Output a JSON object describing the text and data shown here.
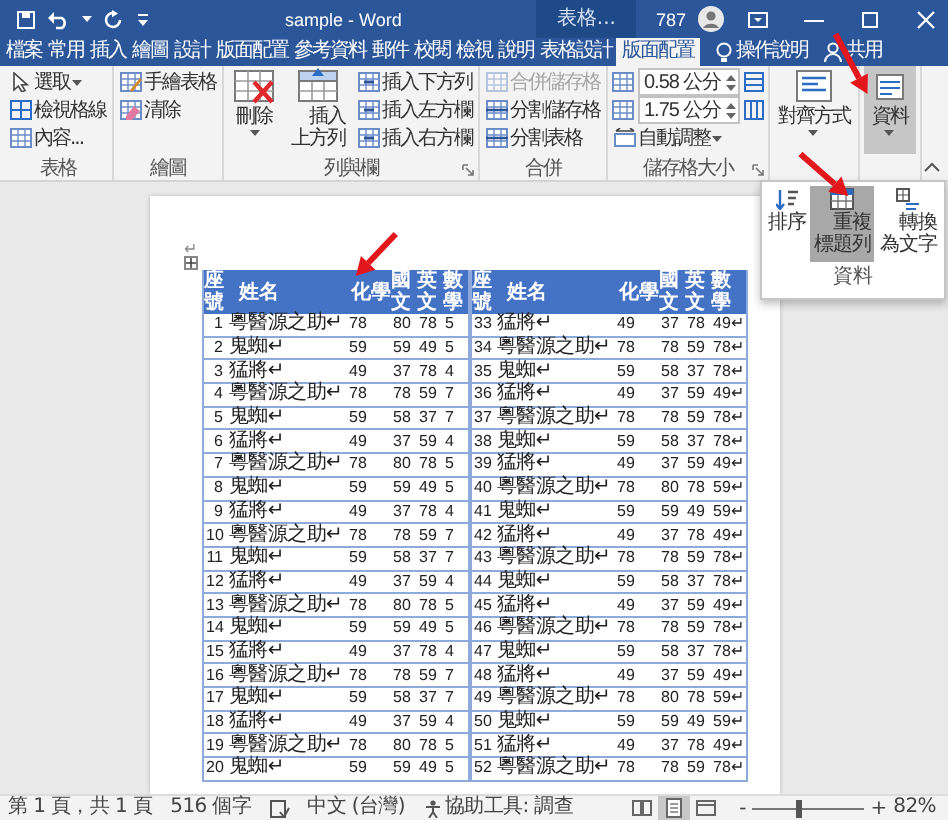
{
  "window": {
    "title": "sample - Word",
    "context_tab_group": "表格...",
    "count": "787"
  },
  "tabs": [
    {
      "label": "檔案",
      "selected": false
    },
    {
      "label": "常用",
      "selected": false
    },
    {
      "label": "插入",
      "selected": false
    },
    {
      "label": "繪圖",
      "selected": false
    },
    {
      "label": "設計",
      "selected": false
    },
    {
      "label": "版面配置",
      "selected": false
    },
    {
      "label": "參考資料",
      "selected": false
    },
    {
      "label": "郵件",
      "selected": false
    },
    {
      "label": "校閱",
      "selected": false
    },
    {
      "label": "檢視",
      "selected": false
    },
    {
      "label": "說明",
      "selected": false
    },
    {
      "label": "表格設計",
      "selected": false
    },
    {
      "label": "版面配置",
      "selected": true
    }
  ],
  "tell_me": "操作說明",
  "share": "共用",
  "ribbon": {
    "groups": [
      {
        "label": "表格",
        "launcher": false,
        "items": [
          {
            "kind": "small",
            "label": "選取",
            "dropdown": true,
            "disabled": false,
            "selected": false
          },
          {
            "kind": "small",
            "label": "檢視格線",
            "dropdown": false,
            "disabled": false,
            "selected": false
          },
          {
            "kind": "small",
            "label": "內容...",
            "dropdown": false,
            "disabled": false,
            "selected": false
          }
        ]
      },
      {
        "label": "繪圖",
        "launcher": false,
        "items": [
          {
            "kind": "small",
            "label": "手繪表格",
            "dropdown": false,
            "disabled": false,
            "selected": false
          },
          {
            "kind": "small",
            "label": "清除",
            "dropdown": false,
            "disabled": false,
            "selected": false
          }
        ]
      },
      {
        "label": "列與欄",
        "launcher": true,
        "items": [
          {
            "kind": "large",
            "label": "刪除",
            "dropdown": true,
            "disabled": false,
            "selected": false
          },
          {
            "kind": "large",
            "label": "插入上方列",
            "dropdown": false,
            "disabled": false,
            "selected": false
          },
          {
            "kind": "small",
            "label": "插入下方列",
            "dropdown": false,
            "disabled": false,
            "selected": false
          },
          {
            "kind": "small",
            "label": "插入左方欄",
            "dropdown": false,
            "disabled": false,
            "selected": false
          },
          {
            "kind": "small",
            "label": "插入右方欄",
            "dropdown": false,
            "disabled": false,
            "selected": false
          }
        ]
      },
      {
        "label": "合併",
        "launcher": false,
        "items": [
          {
            "kind": "small",
            "label": "合併儲存格",
            "dropdown": false,
            "disabled": true,
            "selected": false
          },
          {
            "kind": "small",
            "label": "分割儲存格",
            "dropdown": false,
            "disabled": false,
            "selected": false
          },
          {
            "kind": "small",
            "label": "分割表格",
            "dropdown": false,
            "disabled": false,
            "selected": false
          }
        ]
      },
      {
        "label": "儲存格大小",
        "launcher": true,
        "items": [
          {
            "kind": "spin",
            "value": "0.58 公分"
          },
          {
            "kind": "spin",
            "value": "1.75 公分"
          },
          {
            "kind": "small",
            "label": "自動調整",
            "dropdown": true,
            "disabled": false,
            "selected": false
          }
        ]
      },
      {
        "launcher": false,
        "items": [
          {
            "kind": "large",
            "label": "對齊方式",
            "dropdown": true,
            "disabled": false,
            "selected": false
          }
        ]
      },
      {
        "launcher": false,
        "items": [
          {
            "kind": "large",
            "label": "資料",
            "dropdown": true,
            "disabled": false,
            "selected": true
          }
        ]
      }
    ]
  },
  "data_popup": {
    "buttons": [
      {
        "label": "排序",
        "selected": false
      },
      {
        "label": "重複標題列",
        "selected": true
      },
      {
        "label": "轉換為文字",
        "selected": false
      }
    ],
    "label": "資料"
  },
  "document": {
    "paragraph_mark": "↵",
    "tables": [
      {
        "headers": [
          "座號",
          "姓名",
          "化學",
          "國文",
          "英文",
          "數學"
        ],
        "rows": [
          [
            "1",
            "粵醫源之助↵",
            "78",
            "80",
            "78",
            "5"
          ],
          [
            "2",
            "鬼蜘↵",
            "59",
            "59",
            "49",
            "5"
          ],
          [
            "3",
            "猛將↵",
            "49",
            "37",
            "78",
            "4"
          ],
          [
            "4",
            "粵醫源之助↵",
            "78",
            "78",
            "59",
            "7"
          ],
          [
            "5",
            "鬼蜘↵",
            "59",
            "58",
            "37",
            "7"
          ],
          [
            "6",
            "猛將↵",
            "49",
            "37",
            "59",
            "4"
          ],
          [
            "7",
            "粵醫源之助↵",
            "78",
            "80",
            "78",
            "5"
          ],
          [
            "8",
            "鬼蜘↵",
            "59",
            "59",
            "49",
            "5"
          ],
          [
            "9",
            "猛將↵",
            "49",
            "37",
            "78",
            "4"
          ],
          [
            "10",
            "粵醫源之助↵",
            "78",
            "78",
            "59",
            "7"
          ],
          [
            "11",
            "鬼蜘↵",
            "59",
            "58",
            "37",
            "7"
          ],
          [
            "12",
            "猛將↵",
            "49",
            "37",
            "59",
            "4"
          ],
          [
            "13",
            "粵醫源之助↵",
            "78",
            "80",
            "78",
            "5"
          ],
          [
            "14",
            "鬼蜘↵",
            "59",
            "59",
            "49",
            "5"
          ],
          [
            "15",
            "猛將↵",
            "49",
            "37",
            "78",
            "4"
          ],
          [
            "16",
            "粵醫源之助↵",
            "78",
            "78",
            "59",
            "7"
          ],
          [
            "17",
            "鬼蜘↵",
            "59",
            "58",
            "37",
            "7"
          ],
          [
            "18",
            "猛將↵",
            "49",
            "37",
            "59",
            "4"
          ],
          [
            "19",
            "粵醫源之助↵",
            "78",
            "80",
            "78",
            "5"
          ],
          [
            "20",
            "鬼蜘↵",
            "59",
            "59",
            "49",
            "5"
          ]
        ]
      },
      {
        "headers": [
          "座號",
          "姓名",
          "化學",
          "國文",
          "英文",
          "數學"
        ],
        "rows": [
          [
            "33",
            "猛將↵",
            "49",
            "37",
            "78",
            "49↵"
          ],
          [
            "34",
            "粵醫源之助↵",
            "78",
            "78",
            "59",
            "78↵"
          ],
          [
            "35",
            "鬼蜘↵",
            "59",
            "58",
            "37",
            "78↵"
          ],
          [
            "36",
            "猛將↵",
            "49",
            "37",
            "59",
            "49↵"
          ],
          [
            "37",
            "粵醫源之助↵",
            "78",
            "78",
            "59",
            "78↵"
          ],
          [
            "38",
            "鬼蜘↵",
            "59",
            "58",
            "37",
            "78↵"
          ],
          [
            "39",
            "猛將↵",
            "49",
            "37",
            "59",
            "49↵"
          ],
          [
            "40",
            "粵醫源之助↵",
            "78",
            "80",
            "78",
            "59↵"
          ],
          [
            "41",
            "鬼蜘↵",
            "59",
            "59",
            "49",
            "59↵"
          ],
          [
            "42",
            "猛將↵",
            "49",
            "37",
            "78",
            "49↵"
          ],
          [
            "43",
            "粵醫源之助↵",
            "78",
            "78",
            "59",
            "78↵"
          ],
          [
            "44",
            "鬼蜘↵",
            "59",
            "58",
            "37",
            "78↵"
          ],
          [
            "45",
            "猛將↵",
            "49",
            "37",
            "59",
            "49↵"
          ],
          [
            "46",
            "粵醫源之助↵",
            "78",
            "78",
            "59",
            "78↵"
          ],
          [
            "47",
            "鬼蜘↵",
            "59",
            "58",
            "37",
            "78↵"
          ],
          [
            "48",
            "猛將↵",
            "49",
            "37",
            "59",
            "49↵"
          ],
          [
            "49",
            "粵醫源之助↵",
            "78",
            "80",
            "78",
            "59↵"
          ],
          [
            "50",
            "鬼蜘↵",
            "59",
            "59",
            "49",
            "59↵"
          ],
          [
            "51",
            "猛將↵",
            "49",
            "37",
            "78",
            "49↵"
          ],
          [
            "52",
            "粵醫源之助↵",
            "78",
            "78",
            "59",
            "78↵"
          ]
        ]
      }
    ]
  },
  "status": {
    "page": "第 1 頁，共 1 頁",
    "words": "516 個字",
    "language": "中文 (台灣)",
    "accessibility": "協助工具: 調查",
    "views": [
      {
        "selected": false
      },
      {
        "selected": true
      },
      {
        "selected": false
      }
    ],
    "zoom": {
      "minus": "-",
      "level": 0.41,
      "plus": "+",
      "reading": "82%"
    }
  }
}
